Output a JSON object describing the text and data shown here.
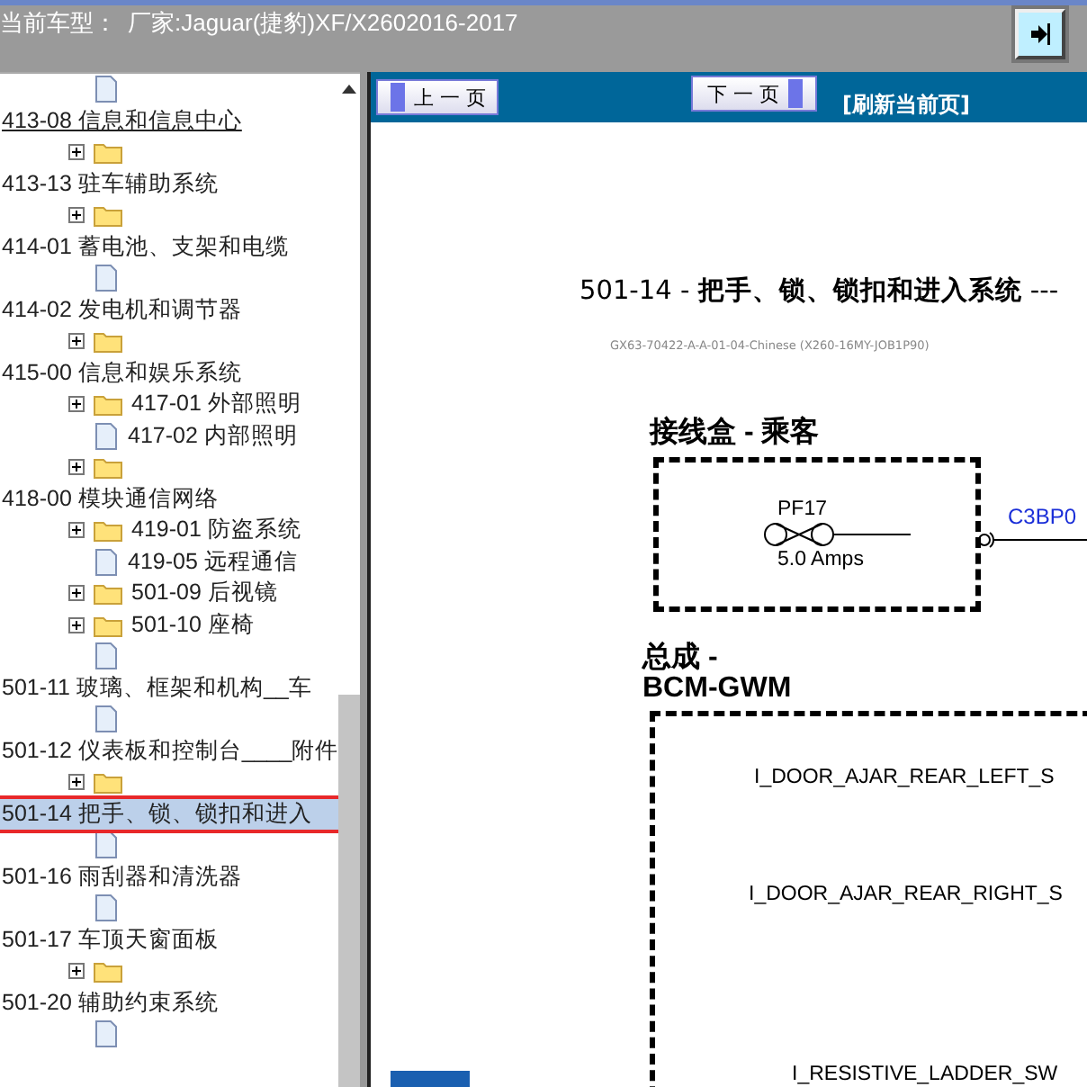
{
  "top_bar": {
    "vehicle_label": "当前车型：",
    "vehicle_value": "厂家:Jaguar(捷豹)XF/X2602016-2017"
  },
  "tree": {
    "leading": [
      {
        "kind": "doc",
        "expandable": false
      }
    ],
    "sections": [
      {
        "label": "413-08 信息和信息中心",
        "selected": false,
        "hovered": true,
        "children": [
          {
            "kind": "folder",
            "expandable": true
          }
        ]
      },
      {
        "label": "413-13 驻车辅助系统",
        "selected": false,
        "hovered": false,
        "children": [
          {
            "kind": "folder",
            "expandable": true
          }
        ]
      },
      {
        "label": "414-01 蓄电池、支架和电缆",
        "selected": false,
        "hovered": false,
        "children": [
          {
            "kind": "doc",
            "expandable": false
          }
        ]
      },
      {
        "label": "414-02 发电机和调节器",
        "selected": false,
        "hovered": false,
        "children": [
          {
            "kind": "folder",
            "expandable": true
          }
        ]
      },
      {
        "label": "415-00 信息和娱乐系统",
        "selected": false,
        "hovered": false,
        "children": [
          {
            "kind": "folder",
            "expandable": true,
            "label": "417-01 外部照明"
          },
          {
            "kind": "doc",
            "expandable": false,
            "label": "417-02 内部照明"
          },
          {
            "kind": "folder",
            "expandable": true
          }
        ]
      },
      {
        "label": "418-00 模块通信网络",
        "selected": false,
        "hovered": false,
        "children": [
          {
            "kind": "folder",
            "expandable": true,
            "label": "419-01 防盗系统"
          },
          {
            "kind": "doc",
            "expandable": false,
            "label": "419-05 远程通信"
          },
          {
            "kind": "folder",
            "expandable": true,
            "label": "501-09 后视镜"
          },
          {
            "kind": "folder",
            "expandable": true,
            "label": "501-10 座椅"
          },
          {
            "kind": "doc",
            "expandable": false
          }
        ]
      },
      {
        "label": "501-11 玻璃、框架和机构__车",
        "selected": false,
        "hovered": false,
        "children": [
          {
            "kind": "doc",
            "expandable": false
          }
        ]
      },
      {
        "label": "501-12 仪表板和控制台____附件",
        "selected": false,
        "hovered": false,
        "children": [
          {
            "kind": "folder",
            "expandable": true
          }
        ]
      },
      {
        "label": "501-14 把手、锁、锁扣和进入",
        "selected": true,
        "hovered": false,
        "children": [
          {
            "kind": "doc",
            "expandable": false
          }
        ]
      },
      {
        "label": "501-16 雨刮器和清洗器",
        "selected": false,
        "hovered": false,
        "children": [
          {
            "kind": "doc",
            "expandable": false
          }
        ]
      },
      {
        "label": "501-17 车顶天窗面板",
        "selected": false,
        "hovered": false,
        "children": [
          {
            "kind": "folder",
            "expandable": true
          }
        ]
      },
      {
        "label": "501-20 辅助约束系统",
        "selected": false,
        "hovered": false,
        "children": [
          {
            "kind": "doc",
            "expandable": false
          }
        ]
      }
    ]
  },
  "nav": {
    "prev": "上 一 页",
    "next": "下 一 页",
    "refresh": "[刷新当前页]"
  },
  "document": {
    "title": "501-14 - **把手、锁、锁扣和进入系统** ---",
    "code": "GX63-70422-A-A-01-04-Chinese (X260-16MY-JOB1P90)",
    "blocks": [
      {
        "heading": "接线盒 - 乘客",
        "fuse": "PF17",
        "rating": "5.0 Amps",
        "connector": "C3BP0"
      },
      {
        "heading_lines": [
          "总成 -",
          "BCM-GWM"
        ],
        "signals": [
          "I_DOOR_AJAR_REAR_LEFT_S",
          "I_DOOR_AJAR_REAR_RIGHT_S",
          "I_RESISTIVE_LADDER_SW"
        ]
      }
    ]
  }
}
